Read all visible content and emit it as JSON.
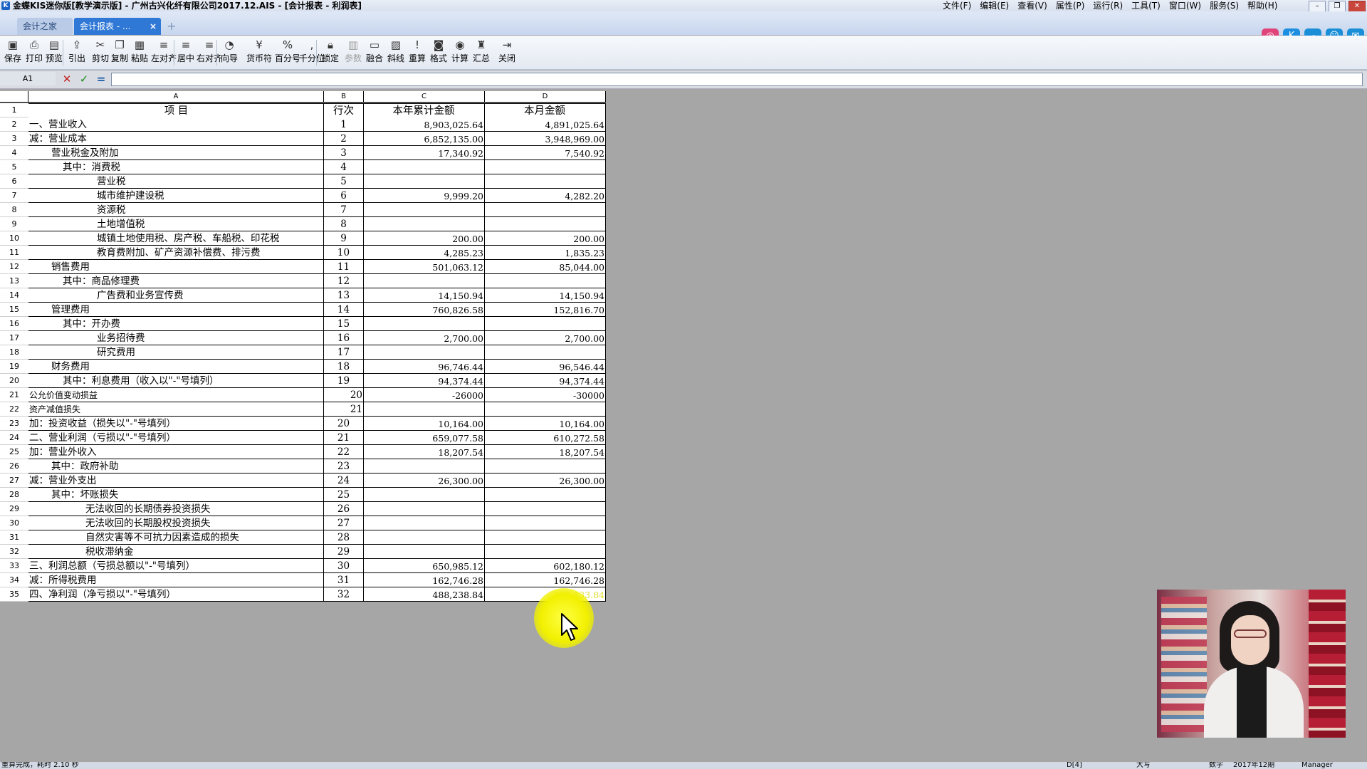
{
  "window": {
    "title": "金蝶KIS迷你版[教学演示版] - 广州古兴化纤有限公司2017.12.AIS - [会计报表 - 利润表]",
    "menu": [
      "文件(F)",
      "编辑(E)",
      "查看(V)",
      "属性(P)",
      "运行(R)",
      "工具(T)",
      "窗口(W)",
      "服务(S)",
      "帮助(H)"
    ]
  },
  "tabs": [
    {
      "label": "会计之家"
    },
    {
      "label": "会计报表 - ..."
    }
  ],
  "tab_add_label": "+",
  "tab_close_label": "×",
  "toolbar": [
    {
      "label": "保存",
      "icon": "save-icon",
      "glyph": "▣"
    },
    {
      "label": "打印",
      "icon": "print-icon",
      "glyph": "⎙"
    },
    {
      "label": "预览",
      "icon": "preview-icon",
      "glyph": "▤"
    },
    {
      "label": "引出",
      "icon": "export-icon",
      "glyph": "⇪"
    },
    {
      "label": "剪切",
      "icon": "cut-icon",
      "glyph": "✂"
    },
    {
      "label": "复制",
      "icon": "copy-icon",
      "glyph": "❐"
    },
    {
      "label": "粘贴",
      "icon": "paste-icon",
      "glyph": "▦"
    },
    {
      "label": "左对齐",
      "icon": "align-left-icon",
      "glyph": "≡"
    },
    {
      "label": "居中",
      "icon": "align-center-icon",
      "glyph": "≡"
    },
    {
      "label": "右对齐",
      "icon": "align-right-icon",
      "glyph": "≡"
    },
    {
      "label": "向导",
      "icon": "wizard-icon",
      "glyph": "◔"
    },
    {
      "label": "货币符",
      "icon": "currency-icon",
      "glyph": "¥"
    },
    {
      "label": "百分号",
      "icon": "percent-icon",
      "glyph": "%"
    },
    {
      "label": "千分位",
      "icon": "thousands-icon",
      "glyph": ","
    },
    {
      "label": "锁定",
      "icon": "lock-icon",
      "glyph": "🔒︎"
    },
    {
      "label": "参数",
      "icon": "params-icon",
      "glyph": "▥",
      "disabled": true
    },
    {
      "label": "融合",
      "icon": "merge-icon",
      "glyph": "▭"
    },
    {
      "label": "斜线",
      "icon": "diagonal-icon",
      "glyph": "▨"
    },
    {
      "label": "重算",
      "icon": "recalc-icon",
      "glyph": "!"
    },
    {
      "label": "格式",
      "icon": "format-icon",
      "glyph": "◙"
    },
    {
      "label": "计算",
      "icon": "calc-icon",
      "glyph": "◉"
    },
    {
      "label": "汇总",
      "icon": "summary-icon",
      "glyph": "♜"
    },
    {
      "label": "关闭",
      "icon": "close-door-icon",
      "glyph": "⇥"
    }
  ],
  "formula_bar": {
    "cell_ref": "A1",
    "cancel_glyph": "✕",
    "accept_glyph": "✓",
    "equals_glyph": "="
  },
  "columns": [
    "A",
    "B",
    "C",
    "D"
  ],
  "header": {
    "item": "项    目",
    "line": "行次",
    "ytd": "本年累计金额",
    "month": "本月金额"
  },
  "rows": [
    {
      "n": "2",
      "item": "一、营业收入",
      "indent": 0,
      "line": "1",
      "ytd": "8,903,025.64",
      "month": "4,891,025.64"
    },
    {
      "n": "3",
      "item": "减：营业成本",
      "indent": 0,
      "line": "2",
      "ytd": "6,852,135.00",
      "month": "3,948,969.00"
    },
    {
      "n": "4",
      "item": "营业税金及附加",
      "indent": 2,
      "line": "3",
      "ytd": "17,340.92",
      "month": "7,540.92"
    },
    {
      "n": "5",
      "item": "其中：消费税",
      "indent": 3,
      "line": "4",
      "ytd": "",
      "month": ""
    },
    {
      "n": "6",
      "item": "营业税",
      "indent": 5,
      "line": "5",
      "ytd": "",
      "month": ""
    },
    {
      "n": "7",
      "item": "城市维护建设税",
      "indent": 5,
      "line": "6",
      "ytd": "9,999.20",
      "month": "4,282.20"
    },
    {
      "n": "8",
      "item": "资源税",
      "indent": 5,
      "line": "7",
      "ytd": "",
      "month": ""
    },
    {
      "n": "9",
      "item": "土地增值税",
      "indent": 5,
      "line": "8",
      "ytd": "",
      "month": ""
    },
    {
      "n": "10",
      "item": "城镇土地使用税、房产税、车船税、印花税",
      "indent": 5,
      "line": "9",
      "ytd": "200.00",
      "month": "200.00"
    },
    {
      "n": "11",
      "item": "教育费附加、矿产资源补偿费、排污费",
      "indent": 5,
      "line": "10",
      "ytd": "4,285.23",
      "month": "1,835.23"
    },
    {
      "n": "12",
      "item": "销售费用",
      "indent": 2,
      "line": "11",
      "ytd": "501,063.12",
      "month": "85,044.00"
    },
    {
      "n": "13",
      "item": "其中：商品修理费",
      "indent": 3,
      "line": "12",
      "ytd": "",
      "month": ""
    },
    {
      "n": "14",
      "item": "广告费和业务宣传费",
      "indent": 5,
      "line": "13",
      "ytd": "14,150.94",
      "month": "14,150.94"
    },
    {
      "n": "15",
      "item": "管理费用",
      "indent": 2,
      "line": "14",
      "ytd": "760,826.58",
      "month": "152,816.70"
    },
    {
      "n": "16",
      "item": "其中：开办费",
      "indent": 3,
      "line": "15",
      "ytd": "",
      "month": ""
    },
    {
      "n": "17",
      "item": "业务招待费",
      "indent": 5,
      "line": "16",
      "ytd": "2,700.00",
      "month": "2,700.00"
    },
    {
      "n": "18",
      "item": "研究费用",
      "indent": 5,
      "line": "17",
      "ytd": "",
      "month": ""
    },
    {
      "n": "19",
      "item": "财务费用",
      "indent": 2,
      "line": "18",
      "ytd": "96,746.44",
      "month": "96,546.44"
    },
    {
      "n": "20",
      "item": "其中：利息费用（收入以\"-\"号填列）",
      "indent": 3,
      "line": "19",
      "ytd": "94,374.44",
      "month": "94,374.44"
    },
    {
      "n": "21",
      "item": "公允价值变动损益",
      "indent": 0,
      "small": true,
      "line": "20",
      "lineRight": true,
      "ytd": "-26000",
      "month": "-30000"
    },
    {
      "n": "22",
      "item": "资产减值损失",
      "indent": 0,
      "small": true,
      "line": "21",
      "lineRight": true,
      "ytd": "",
      "month": ""
    },
    {
      "n": "23",
      "item": "加：投资收益（损失以\"-\"号填列）",
      "indent": 0,
      "line": "20",
      "ytd": "10,164.00",
      "month": "10,164.00"
    },
    {
      "n": "24",
      "item": "二、营业利润（亏损以\"-\"号填列）",
      "indent": 0,
      "line": "21",
      "ytd": "659,077.58",
      "month": "610,272.58"
    },
    {
      "n": "25",
      "item": "加：营业外收入",
      "indent": 0,
      "line": "22",
      "ytd": "18,207.54",
      "month": "18,207.54"
    },
    {
      "n": "26",
      "item": "其中：政府补助",
      "indent": 2,
      "line": "23",
      "ytd": "",
      "month": ""
    },
    {
      "n": "27",
      "item": "减：营业外支出",
      "indent": 0,
      "line": "24",
      "ytd": "26,300.00",
      "month": "26,300.00"
    },
    {
      "n": "28",
      "item": "其中：坏账损失",
      "indent": 2,
      "line": "25",
      "ytd": "",
      "month": ""
    },
    {
      "n": "29",
      "item": "无法收回的长期债券投资损失",
      "indent": 4,
      "line": "26",
      "ytd": "",
      "month": ""
    },
    {
      "n": "30",
      "item": "无法收回的长期股权投资损失",
      "indent": 4,
      "line": "27",
      "ytd": "",
      "month": ""
    },
    {
      "n": "31",
      "item": "自然灾害等不可抗力因素造成的损失",
      "indent": 4,
      "line": "28",
      "ytd": "",
      "month": ""
    },
    {
      "n": "32",
      "item": "税收滞纳金",
      "indent": 4,
      "line": "29",
      "ytd": "",
      "month": ""
    },
    {
      "n": "33",
      "item": "三、利润总额（亏损总额以\"-\"号填列）",
      "indent": 0,
      "line": "30",
      "ytd": "650,985.12",
      "month": "602,180.12"
    },
    {
      "n": "34",
      "item": "减：所得税费用",
      "indent": 0,
      "line": "31",
      "ytd": "162,746.28",
      "month": "162,746.28"
    },
    {
      "n": "35",
      "item": "四、净利润（净亏损以\"-\"号填列）",
      "indent": 0,
      "line": "32",
      "ytd": "488,238.84",
      "month": "439,433.84"
    }
  ],
  "header_row_number": "1",
  "status": {
    "message": "重算完成，耗时 2.10 秒",
    "position": "D[4]",
    "caps": "大写",
    "num": "数字",
    "period": "2017年12期",
    "user": "Manager"
  },
  "colors": {
    "active_tab": "#2f78d6",
    "highlight": "#f2f000",
    "sheet_bg": "#a6a6a6"
  }
}
